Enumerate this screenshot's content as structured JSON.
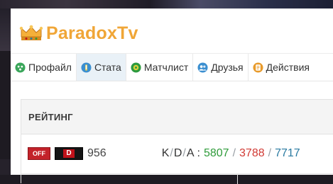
{
  "profile": {
    "name": "ParadoxTv"
  },
  "tabs": [
    {
      "label": "Профайл",
      "icon": "profile-icon",
      "color": "#3aa65a",
      "active": false
    },
    {
      "label": "Стата",
      "icon": "stats-icon",
      "color": "#3b8fd0",
      "active": true
    },
    {
      "label": "Матчлист",
      "icon": "matchlist-icon",
      "color": "#2c9a3e",
      "active": false
    },
    {
      "label": "Друзья",
      "icon": "friends-icon",
      "color": "#3b8fd0",
      "active": false
    },
    {
      "label": "Действия",
      "icon": "actions-icon",
      "color": "#e89a2a",
      "active": false
    }
  ],
  "rating": {
    "header": "РЕЙТИНГ",
    "status_badge": "OFF",
    "rank_badge": "D",
    "value": "956"
  },
  "kda": {
    "label_k": "K",
    "label_d": "D",
    "label_a": "A",
    "label_sep": "/",
    "colon": ":",
    "kills": "5807",
    "deaths": "3788",
    "assists": "7717",
    "value_sep": "/"
  },
  "colors": {
    "name": "#f0a637",
    "kills": "#2e9b3a",
    "deaths": "#d13a34",
    "assists": "#2a7aa1",
    "off_badge": "#c3222a"
  }
}
